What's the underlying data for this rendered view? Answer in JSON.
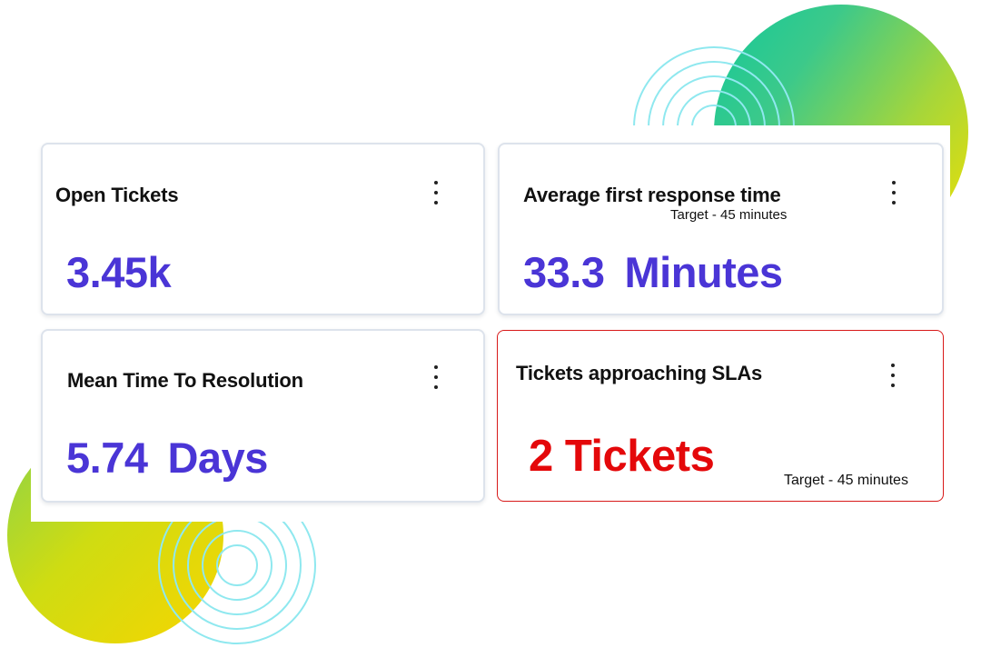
{
  "cards": [
    {
      "title": "Open Tickets",
      "value": "3.45k",
      "menu_icon": "kebab-menu-icon"
    },
    {
      "title": "Average first response time",
      "subtitle": "Target - 45 minutes",
      "value_number": "33.3",
      "value_unit": "Minutes",
      "menu_icon": "kebab-menu-icon"
    },
    {
      "title": "Mean Time To Resolution",
      "value_number": "5.74",
      "value_unit": "Days",
      "menu_icon": "kebab-menu-icon"
    },
    {
      "title": "Tickets approaching SLAs",
      "value": "2 Tickets",
      "footnote": "Target - 45 minutes",
      "menu_icon": "kebab-menu-icon"
    }
  ],
  "colors": {
    "value_accent": "#4a35d6",
    "alert_value": "#e4080a",
    "alert_border": "#d81919",
    "card_border": "#dde3ec",
    "decoration_green": "#12c99a",
    "decoration_yellow": "#f2e000",
    "decoration_rings": "#8fe8ef"
  }
}
